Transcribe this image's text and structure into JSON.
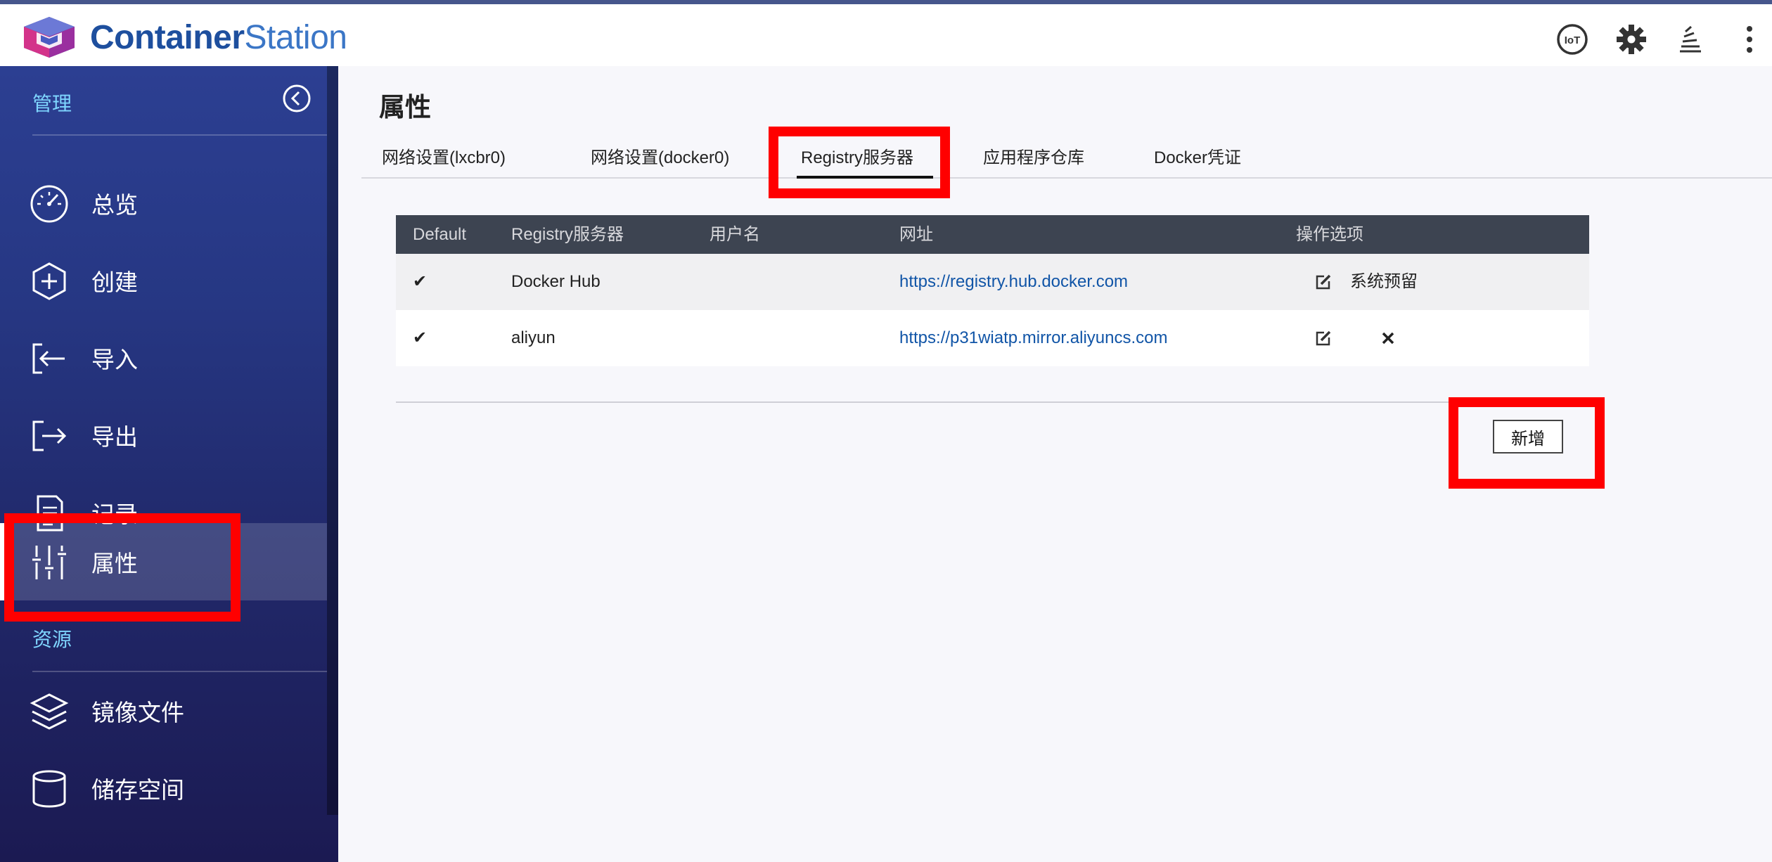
{
  "app": {
    "brand_part1": "Container",
    "brand_part2": "Station"
  },
  "topbar": {
    "icons": [
      "iot-icon",
      "gear-icon",
      "stack-icon",
      "more-vertical-icon"
    ],
    "iot_label": "IoT"
  },
  "sidebar": {
    "section_manage": "管理",
    "section_resources": "资源",
    "items": [
      {
        "label": "总览",
        "icon": "gauge-icon"
      },
      {
        "label": "创建",
        "icon": "plus-hexagon-icon"
      },
      {
        "label": "导入",
        "icon": "import-icon"
      },
      {
        "label": "导出",
        "icon": "export-icon"
      },
      {
        "label": "记录",
        "icon": "document-icon"
      },
      {
        "label": "属性",
        "icon": "sliders-icon",
        "active": true
      },
      {
        "label": "镜像文件",
        "icon": "layers-icon"
      },
      {
        "label": "储存空间",
        "icon": "cylinder-icon"
      }
    ]
  },
  "main": {
    "title": "属性",
    "tabs": [
      {
        "label": "网络设置(lxcbr0)"
      },
      {
        "label": "网络设置(docker0)"
      },
      {
        "label": "Registry服务器",
        "active": true
      },
      {
        "label": "应用程序仓库"
      },
      {
        "label": "Docker凭证"
      }
    ],
    "table": {
      "headers": [
        "Default",
        "Registry服务器",
        "用户名",
        "网址",
        "操作选项"
      ],
      "rows": [
        {
          "default": "✔",
          "server": "Docker Hub",
          "username": "",
          "url": "https://registry.hub.docker.com",
          "action_text": "系统预留"
        },
        {
          "default": "✔",
          "server": "aliyun",
          "username": "",
          "url": "https://p31wiatp.mirror.aliyuncs.com",
          "action_text": ""
        }
      ]
    },
    "add_button": "新增"
  },
  "colors": {
    "accent": "#1e4f9e",
    "link": "#1155a7",
    "highlight": "#ff0000",
    "table_header": "#3d4451"
  }
}
